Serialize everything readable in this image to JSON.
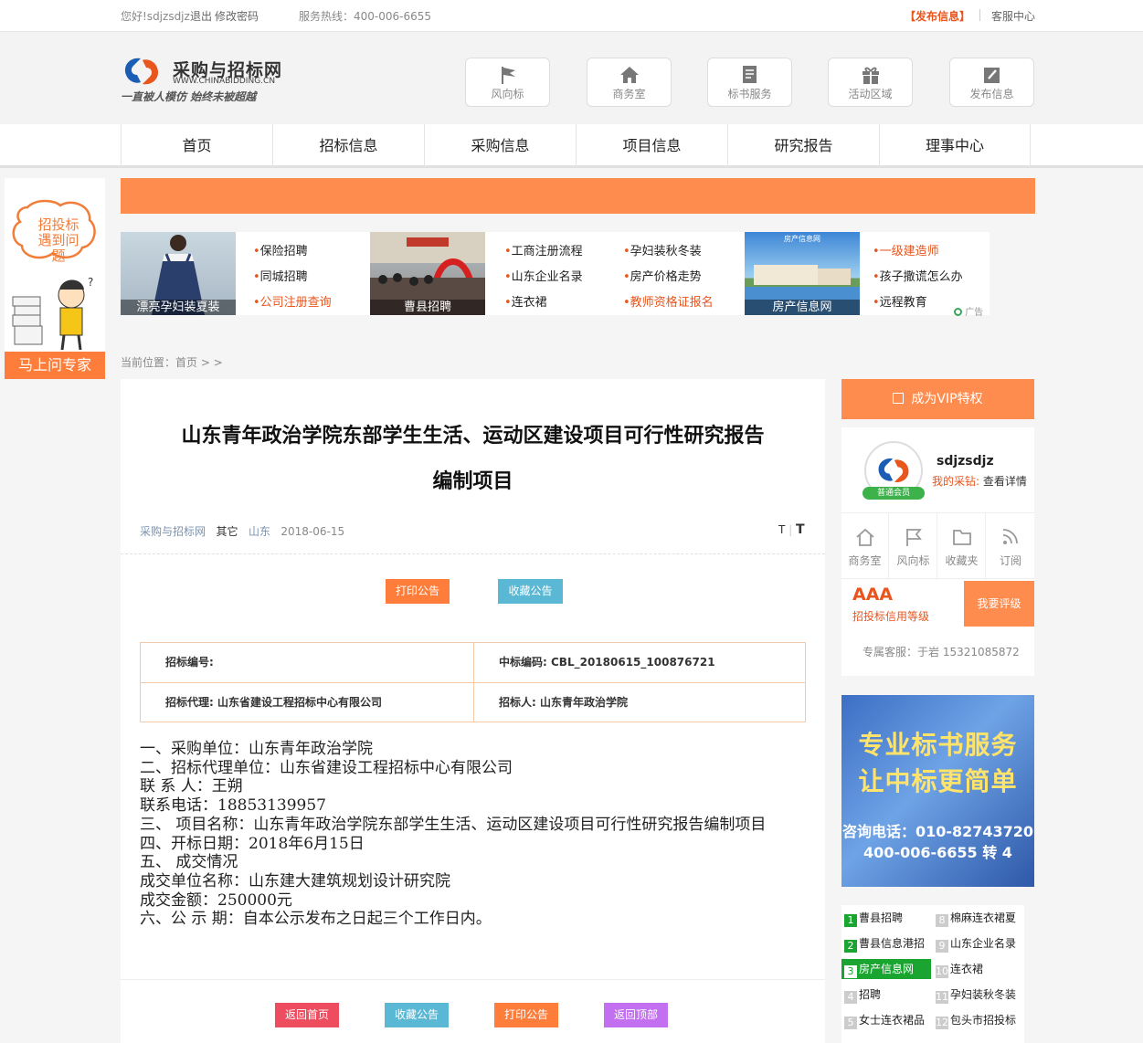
{
  "topbar": {
    "greeting": "您好!sdjzsdjz",
    "logout": "退出",
    "change_password": "修改密码",
    "hotline": "服务热线：400-006-6655",
    "post_info": "【发布信息】",
    "service_center": "客服中心"
  },
  "logo": {
    "name": "采购与招标网",
    "url": "WWW.CHINABIDDING.CN",
    "slogan": "一直被人模仿  始终未被超越"
  },
  "header_buttons": [
    {
      "label": "风向标",
      "icon": "flag-icon"
    },
    {
      "label": "商务室",
      "icon": "home-icon"
    },
    {
      "label": "标书服务",
      "icon": "document-icon"
    },
    {
      "label": "活动区域",
      "icon": "gift-icon"
    },
    {
      "label": "发布信息",
      "icon": "edit-icon"
    }
  ],
  "nav": [
    "首页",
    "招标信息",
    "采购信息",
    "项目信息",
    "研究报告",
    "理事中心"
  ],
  "qa": {
    "bubble": "招投标遇到问题",
    "button": "马上问专家"
  },
  "ads": {
    "images": [
      "漂亮孕妇装夏装",
      "曹县招聘",
      "房产信息网"
    ],
    "real_estate_logo": "房产信息网",
    "col1": [
      "保险招聘",
      "同城招聘",
      "公司注册查询"
    ],
    "col2": [
      "工商注册流程",
      "山东企业名录",
      "连衣裙"
    ],
    "col3": [
      "孕妇装秋冬装",
      "房产价格走势",
      "教师资格证报名"
    ],
    "col4": [
      "一级建造师",
      "孩子撒谎怎么办",
      "远程教育"
    ],
    "ad_label": "广告"
  },
  "breadcrumb": "当前位置：首页 > >",
  "article": {
    "title_line1": "山东青年政治学院东部学生生活、运动区建设项目可行性研究报告",
    "title_line2": "编制项目",
    "source": "采购与招标网",
    "category": "其它",
    "region": "山东",
    "date": "2018-06-15",
    "font_small": "T",
    "font_large": "T",
    "print_button": "打印公告",
    "favorite_button": "收藏公告",
    "info": {
      "bid_no_label": "招标编号:",
      "winning_code_label": "中标编码:",
      "winning_code": "CBL_20180615_100876721",
      "agent_label": "招标代理:",
      "agent": "山东省建设工程招标中心有限公司",
      "tenderer_label": "招标人:",
      "tenderer": "山东青年政治学院"
    },
    "lines": [
      "一、采购单位：山东青年政治学院",
      "二、招标代理单位：山东省建设工程招标中心有限公司",
      "联 系 人：王朔",
      "联系电话：18853139957",
      "三、 项目名称：山东青年政治学院东部学生生活、运动区建设项目可行性研究报告编制项目",
      "四、开标日期：2018年6月15日",
      "五、 成交情况",
      "成交单位名称：山东建大建筑规划设计研究院",
      "成交金额：250000元",
      "六、公 示 期：自本公示发布之日起三个工作日内。"
    ],
    "bottom_buttons": {
      "home": "返回首页",
      "favorite": "收藏公告",
      "print": "打印公告",
      "top": "返回顶部"
    }
  },
  "sidebar": {
    "vip": "成为VIP特权",
    "username": "sdjzsdjz",
    "my_procurement": "我的采钻:",
    "view_details": "查看详情",
    "member_badge": "普通会员",
    "quick": [
      "商务室",
      "风向标",
      "收藏夹",
      "订阅"
    ],
    "credit_grade": "AAA",
    "credit_label": "招投标信用等级",
    "rate_button": "我要评级",
    "customer_service": "专属客服：于岩 15321085872",
    "ad": {
      "line1": "专业标书服务",
      "line2": "让中标更简单",
      "line3": "咨询电话：010-82743720",
      "line4": "400-006-6655 转 4"
    },
    "rank_left": [
      "曹县招聘",
      "曹县信息港招",
      "房产信息网",
      "招聘",
      "女士连衣裙品"
    ],
    "rank_right": [
      "棉麻连衣裙夏",
      "山东企业名录",
      "连衣裙",
      "孕妇装秋冬装",
      "包头市招投标"
    ]
  },
  "colors": {
    "accent": "#ff8c4f",
    "post": "#e8551d",
    "print": "#ff7d3a",
    "favorite": "#5bb8d4",
    "home": "#ee4c5f",
    "top": "#c26ff0",
    "rank_green": "#1aa531"
  }
}
